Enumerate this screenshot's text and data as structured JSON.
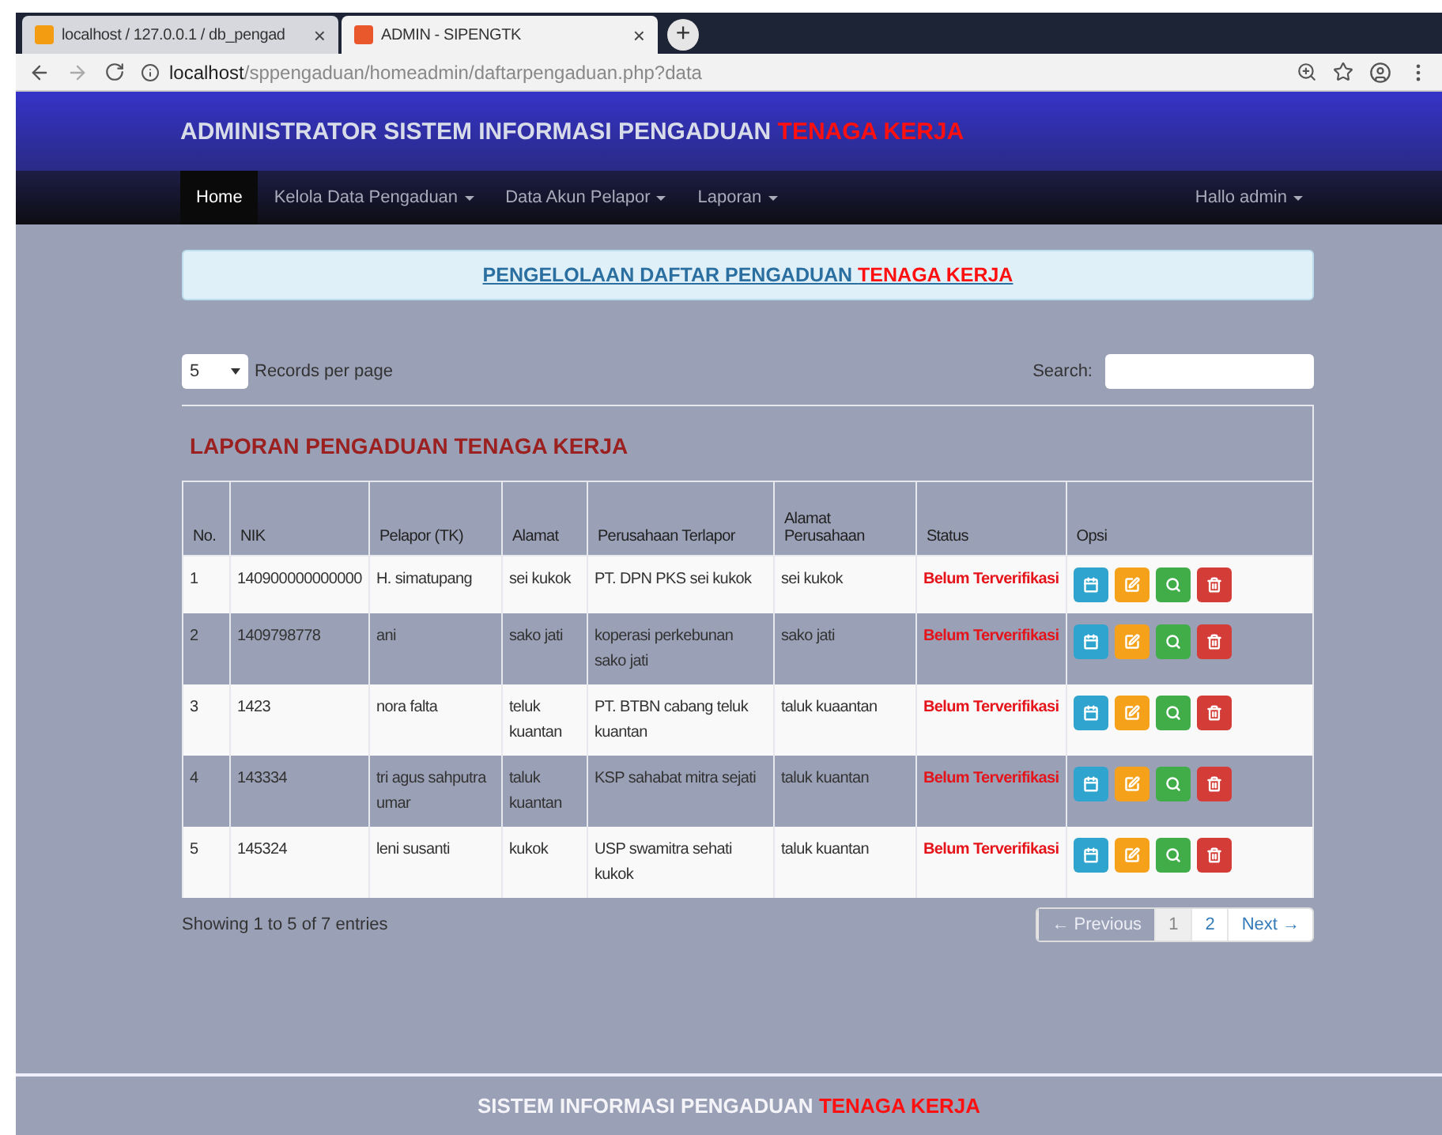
{
  "browser": {
    "tabs": [
      {
        "title": "localhost / 127.0.0.1 / db_pengad",
        "close": "×",
        "selected": false
      },
      {
        "title": "ADMIN - SIPENGTK",
        "close": "×",
        "selected": true
      }
    ],
    "new_tab": "+",
    "url_host": "localhost",
    "url_path": "/sppengaduan/homeadmin/daftarpengaduan.php?data"
  },
  "header": {
    "title": "ADMINISTRATOR SISTEM INFORMASI PENGADUAN ",
    "title_highlight": "TENAGA KERJA"
  },
  "nav": {
    "items": [
      {
        "label": "Home",
        "selected": true,
        "dropdown": false
      },
      {
        "label": "Kelola Data Pengaduan",
        "selected": false,
        "dropdown": true
      },
      {
        "label": "Data Akun Pelapor",
        "selected": false,
        "dropdown": true
      },
      {
        "label": "Laporan",
        "selected": false,
        "dropdown": true
      }
    ],
    "user": "Hallo admin"
  },
  "banner": {
    "text": "PENGELOLAAN DAFTAR PENGADUAN ",
    "highlight": "TENAGA KERJA"
  },
  "controls": {
    "page_size": "5",
    "page_size_label": "Records per page",
    "search_label": "Search:"
  },
  "panel": {
    "title": "LAPORAN PENGADUAN TENAGA KERJA"
  },
  "table": {
    "columns": [
      "No.",
      "NIK",
      "Pelapor (TK)",
      "Alamat",
      "Perusahaan Terlapor",
      "Alamat Perusahaan",
      "Status",
      "Opsi"
    ],
    "rows": [
      {
        "cells": [
          "1",
          "140900000000000",
          "H. simatupang",
          "sei kukok",
          "PT. DPN PKS sei kukok",
          "sei kukok"
        ],
        "status": "Belum Terverifikasi"
      },
      {
        "cells": [
          "2",
          "1409798778",
          "ani",
          "sako jati",
          "koperasi perkebunan sako jati",
          "sako jati"
        ],
        "status": "Belum Terverifikasi"
      },
      {
        "cells": [
          "3",
          "1423",
          "nora falta",
          "teluk kuantan",
          "PT. BTBN cabang teluk kuantan",
          "taluk kuaantan"
        ],
        "status": "Belum Terverifikasi"
      },
      {
        "cells": [
          "4",
          "143334",
          "tri agus sahputra umar",
          "taluk kuantan",
          "KSP sahabat mitra sejati",
          "taluk kuantan"
        ],
        "status": "Belum Terverifikasi"
      },
      {
        "cells": [
          "5",
          "145324",
          "leni susanti",
          "kukok",
          "USP swamitra sehati kukok",
          "taluk kuantan"
        ],
        "status": "Belum Terverifikasi"
      }
    ]
  },
  "info": "Showing 1 to 5 of 7 entries",
  "pagination": [
    {
      "label": "← Previous",
      "selected": false,
      "disabled": true
    },
    {
      "label": "1",
      "selected": true,
      "disabled": false
    },
    {
      "label": "2",
      "selected": false,
      "disabled": false
    },
    {
      "label": "Next →",
      "selected": false,
      "disabled": false
    }
  ],
  "footer": {
    "text": "SISTEM INFORMASI PENGADUAN ",
    "highlight": "TENAGA KERJA"
  }
}
